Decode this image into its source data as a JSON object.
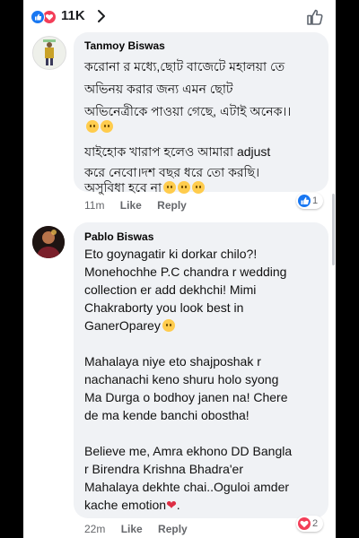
{
  "post": {
    "reaction_count": "11K",
    "reactions": [
      "like-icon",
      "love-icon"
    ]
  },
  "comments": [
    {
      "author": "Tanmoy Biswas",
      "lines": [
        "করোনা র মধ্যে,ছোট বাজেটে মহালয়া তে",
        "অভিনয় করার জন্য  এমন ছোট",
        "অভিনেত্রীকে পাওয়া গেছে, এটাই অনেক।।",
        "",
        "যাইহোক খারাপ হলেও আমারা adjust",
        "করে নেবো।দশ বছর ধরে তো করছি।",
        "অসুবিধা হবে না"
      ],
      "time": "11m",
      "like_label": "Like",
      "reply_label": "Reply",
      "reaction_count": "1",
      "reaction_color": "#1877f2"
    },
    {
      "author": "Pablo Biswas",
      "lines": [
        "Eto goynagatir ki dorkar chilo?!",
        "Monehochhe P.C chandra r wedding",
        "collection er add dekhchi! Mimi",
        "Chakraborty you look best in",
        "GanerOparey",
        "",
        "Mahalaya niye eto shajposhak r",
        "nachanachi keno shuru holo syong",
        "Ma Durga o bodhoy janen na! Chere",
        "de ma kende banchi obostha!",
        "",
        "Believe me, Amra  ekhono DD Bangla",
        "r Birendra Krishna Bhadra'er",
        "Mahalaya dekhte chai..Oguloi amder",
        "kache emotion"
      ],
      "time": "22m",
      "like_label": "Like",
      "reply_label": "Reply",
      "reaction_count": "2",
      "reaction_color": "#f33e58"
    }
  ]
}
